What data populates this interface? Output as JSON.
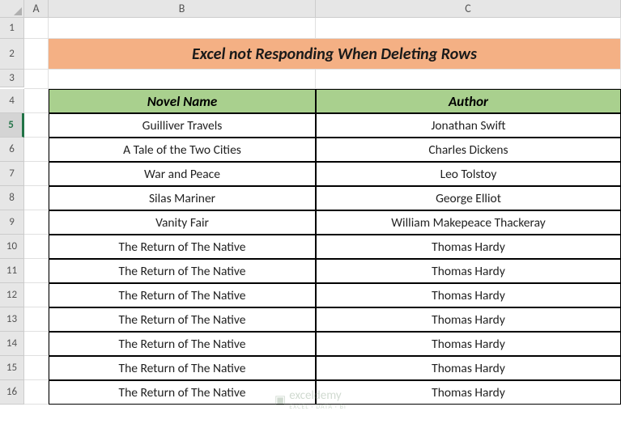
{
  "columns": [
    "A",
    "B",
    "C"
  ],
  "rows": [
    "1",
    "2",
    "3",
    "4",
    "5",
    "6",
    "7",
    "8",
    "9",
    "10",
    "11",
    "12",
    "13",
    "14",
    "15",
    "16"
  ],
  "selectedRow": "5",
  "title": "Excel not Responding When Deleting Rows",
  "headers": {
    "novel": "Novel Name",
    "author": "Author"
  },
  "data": [
    {
      "novel": "Guilliver Travels",
      "author": "Jonathan Swift"
    },
    {
      "novel": "A Tale of the Two Cities",
      "author": "Charles Dickens"
    },
    {
      "novel": "War and Peace",
      "author": "Leo Tolstoy"
    },
    {
      "novel": "Silas Mariner",
      "author": "George Elliot"
    },
    {
      "novel": "Vanity Fair",
      "author": "William Makepeace Thackeray"
    },
    {
      "novel": "The Return of The Native",
      "author": "Thomas Hardy"
    },
    {
      "novel": "The Return of The Native",
      "author": "Thomas Hardy"
    },
    {
      "novel": "The Return of The Native",
      "author": "Thomas Hardy"
    },
    {
      "novel": "The Return of The Native",
      "author": "Thomas Hardy"
    },
    {
      "novel": "The Return of The Native",
      "author": "Thomas Hardy"
    },
    {
      "novel": "The Return of The Native",
      "author": "Thomas Hardy"
    },
    {
      "novel": "The Return of The Native",
      "author": "Thomas Hardy"
    }
  ],
  "watermark": {
    "main": "exceldemy",
    "sub": "EXCEL · DATA · BI"
  }
}
